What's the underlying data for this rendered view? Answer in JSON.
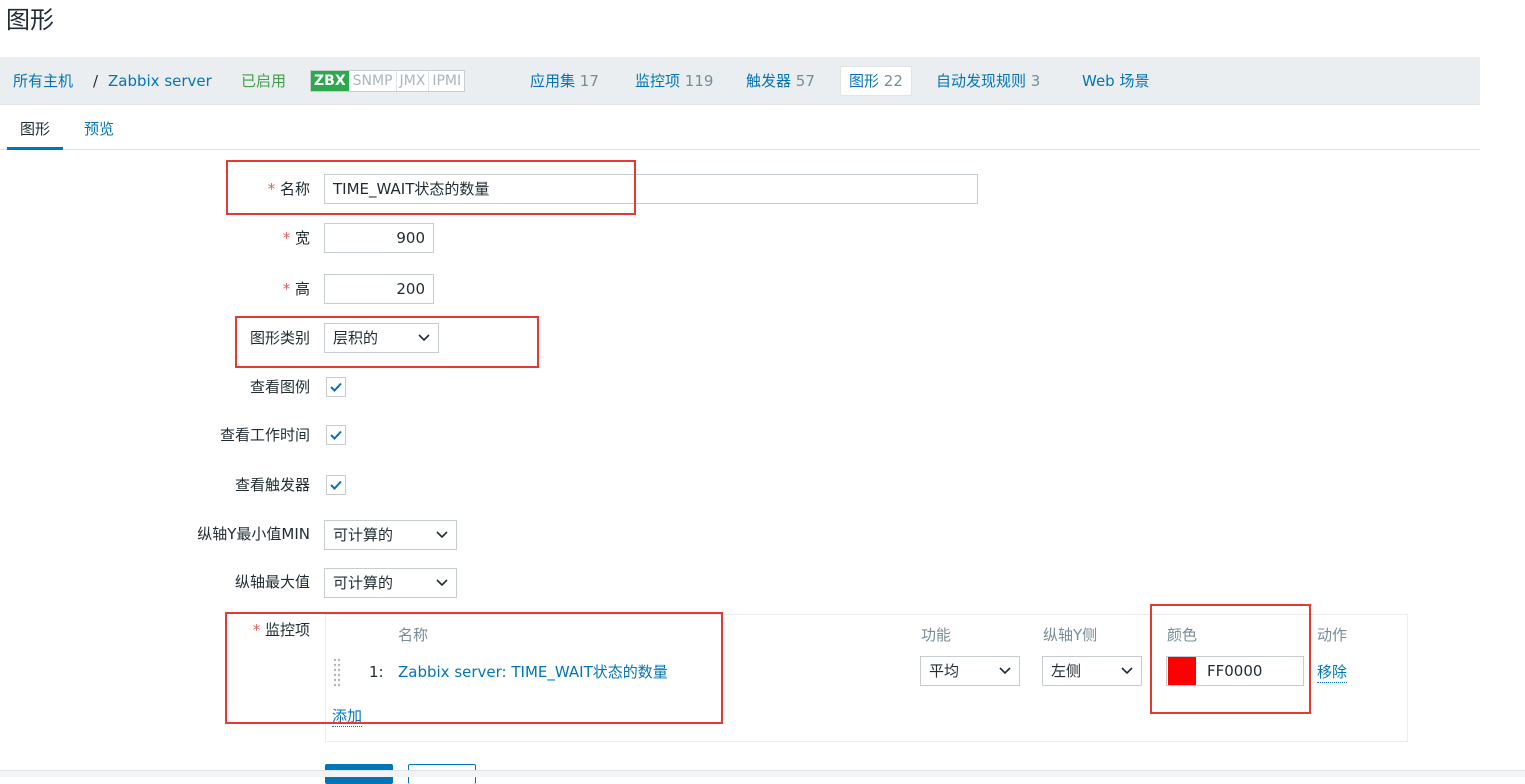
{
  "page_title": "图形",
  "host_nav": {
    "all_hosts": "所有主机",
    "separator": "/",
    "host": "Zabbix server",
    "status": "已启用",
    "availability": [
      "ZBX",
      "SNMP",
      "JMX",
      "IPMI"
    ],
    "applications_label": "应用集",
    "applications_count": "17",
    "items_label": "监控项",
    "items_count": "119",
    "triggers_label": "触发器",
    "triggers_count": "57",
    "graphs_label": "图形",
    "graphs_count": "22",
    "discovery_label": "自动发现规则",
    "discovery_count": "3",
    "web_label": "Web 场景"
  },
  "tabs": {
    "graph": "图形",
    "preview": "预览"
  },
  "form": {
    "name_label": "名称",
    "name_value": "TIME_WAIT状态的数量",
    "width_label": "宽",
    "width_value": "900",
    "height_label": "高",
    "height_value": "200",
    "graph_type_label": "图形类别",
    "graph_type_value": "层积的",
    "show_legend_label": "查看图例",
    "show_working_time_label": "查看工作时间",
    "show_triggers_label": "查看触发器",
    "ymin_label": "纵轴Y最小值MIN",
    "ymin_value": "可计算的",
    "ymax_label": "纵轴最大值",
    "ymax_value": "可计算的",
    "items_label": "监控项"
  },
  "items_table": {
    "headers": {
      "name": "名称",
      "function": "功能",
      "axis": "纵轴Y侧",
      "color": "颜色",
      "action": "动作"
    },
    "rows": [
      {
        "index": "1:",
        "name": "Zabbix server: TIME_WAIT状态的数量",
        "function": "平均",
        "axis": "左侧",
        "color": "FF0000",
        "action": "移除"
      }
    ],
    "add": "添加"
  },
  "colors": {
    "accent": "#0275b8",
    "zbx_green": "#2ca84d",
    "item_color": "#ff0000",
    "highlight": "#e53935"
  }
}
